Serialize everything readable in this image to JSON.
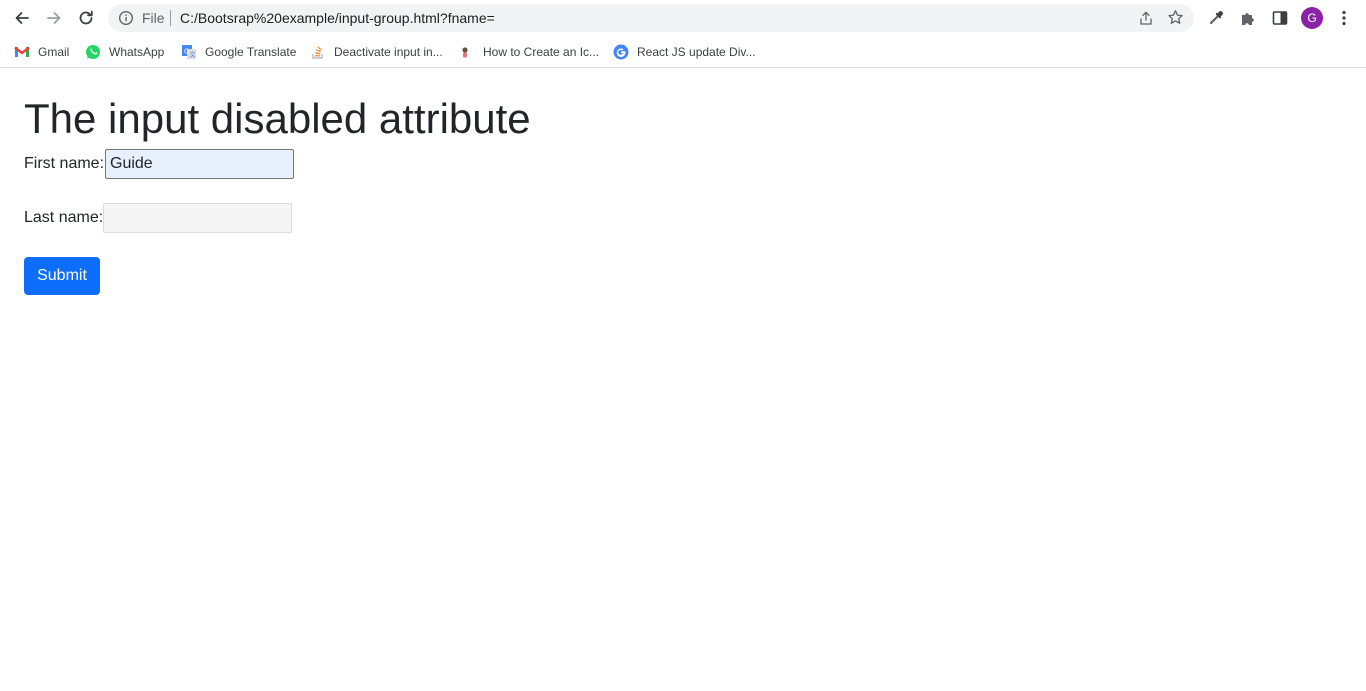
{
  "browser": {
    "address_bar": {
      "scheme_label": "File",
      "url": "C:/Bootsrap%20example/input-group.html?fname="
    },
    "profile_initial": "G",
    "profile_color": "#8a23a8",
    "toolbar_icons": [
      "back-icon",
      "forward-icon",
      "reload-icon",
      "info-icon",
      "share-icon",
      "star-icon",
      "eyedropper-icon",
      "extensions-icon",
      "side-panel-icon",
      "menu-icon"
    ]
  },
  "bookmarks": [
    {
      "label": "Gmail",
      "icon": "gmail-icon"
    },
    {
      "label": "WhatsApp",
      "icon": "whatsapp-icon"
    },
    {
      "label": "Google Translate",
      "icon": "google-translate-icon"
    },
    {
      "label": "Deactivate input in...",
      "icon": "stackoverflow-icon"
    },
    {
      "label": "How to Create an Ic...",
      "icon": "site-icon"
    },
    {
      "label": "React JS update Div...",
      "icon": "google-icon"
    }
  ],
  "page": {
    "title": "The input disabled attribute",
    "first_name_label": "First name:",
    "first_name_value": "Guide",
    "last_name_label": "Last name:",
    "last_name_value": "",
    "submit_label": "Submit",
    "accent_color": "#0d6efd"
  }
}
